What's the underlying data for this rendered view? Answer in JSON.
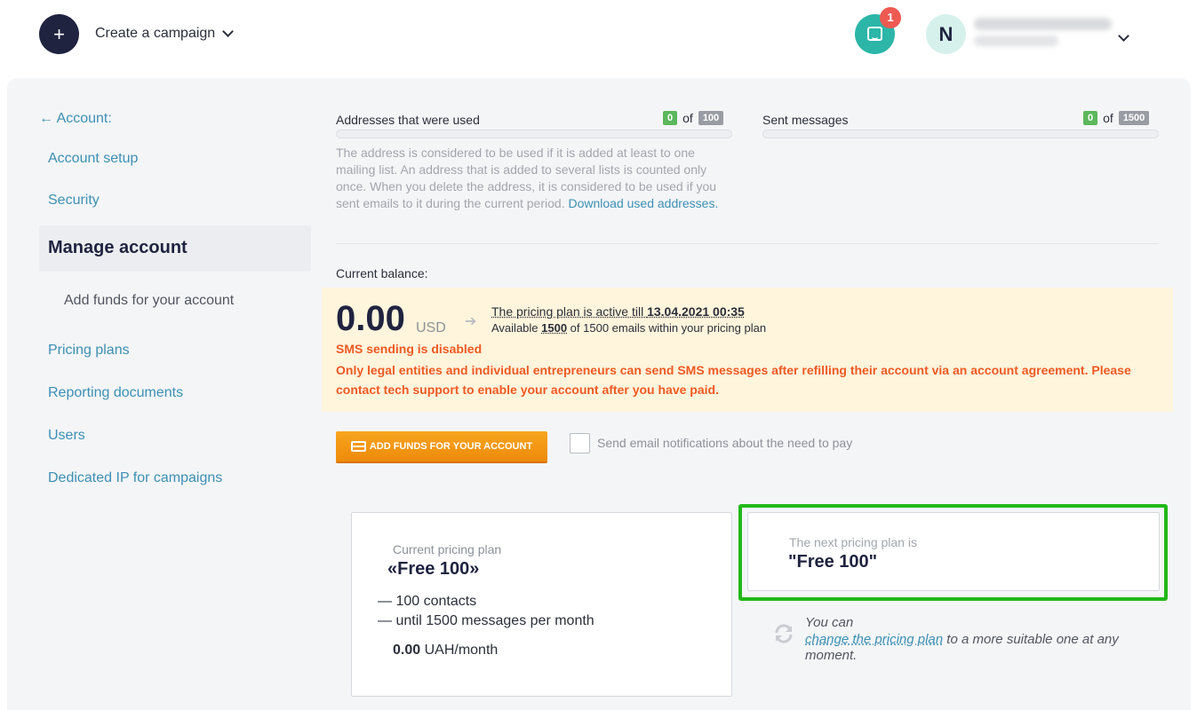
{
  "header": {
    "create_button_symbol": "+",
    "create_label": "Create a campaign",
    "notification_count": "1",
    "avatar_initial": "N"
  },
  "sidebar": {
    "back_label": "← Account:",
    "items": [
      {
        "label": "Account setup"
      },
      {
        "label": "Security"
      },
      {
        "label": "Manage account"
      },
      {
        "label": "Add funds for your account"
      },
      {
        "label": "Pricing plans"
      },
      {
        "label": "Reporting documents"
      },
      {
        "label": "Users"
      },
      {
        "label": "Dedicated IP for campaigns"
      }
    ]
  },
  "usage": {
    "addresses": {
      "title": "Addresses that were used",
      "used": "0",
      "of_label": "of",
      "total": "100"
    },
    "messages": {
      "title": "Sent messages",
      "used": "0",
      "of_label": "of",
      "total": "1500"
    },
    "note": "The address is considered to be used if it is added at least to one mailing list. An address that is added to several lists is counted only once. When you delete the address, it is considered to be used if you sent emails to it during the current period.",
    "note_link": "Download used addresses."
  },
  "balance": {
    "label": "Current balance:",
    "amount": "0.00",
    "currency": "USD",
    "plan_active_prefix": "The pricing plan is active till ",
    "plan_active_date": "13.04.2021 00:35",
    "available_prefix": "Available ",
    "available_count": "1500",
    "available_suffix": " of 1500 emails within your pricing plan",
    "sms_disabled": "SMS sending is disabled",
    "sms_note": "Only legal entities and individual entrepreneurs can send SMS messages after refilling their account via an account agreement. Please contact tech support to enable your account after you have paid."
  },
  "actions": {
    "add_funds": "ADD FUNDS FOR YOUR ACCOUNT",
    "notify_checkbox_label": "Send email notifications about the need to pay"
  },
  "current_plan": {
    "label": "Current pricing plan",
    "name": "«Free 100»",
    "features": [
      "— 100 contacts",
      "— until 1500 messages per month"
    ],
    "price_value": "0.00",
    "price_unit": " UAH/month"
  },
  "next_plan": {
    "label": "The next pricing plan is",
    "name": "\"Free 100\""
  },
  "change_note": {
    "prefix": "You can",
    "link": "change the pricing plan",
    "suffix": " to a more suitable one at any moment."
  },
  "colors": {
    "accent_link": "#3d8fb3",
    "warning_text": "#ee5a24",
    "balance_bg": "#fff4dc",
    "button_orange": "#f29a15",
    "highlight_green": "#22b818",
    "dark_navy": "#1f2340"
  },
  "icons": [
    "plus-icon",
    "chevron-down-icon",
    "inbox-icon",
    "arrow-right-icon",
    "credit-card-icon",
    "refresh-icon"
  ]
}
